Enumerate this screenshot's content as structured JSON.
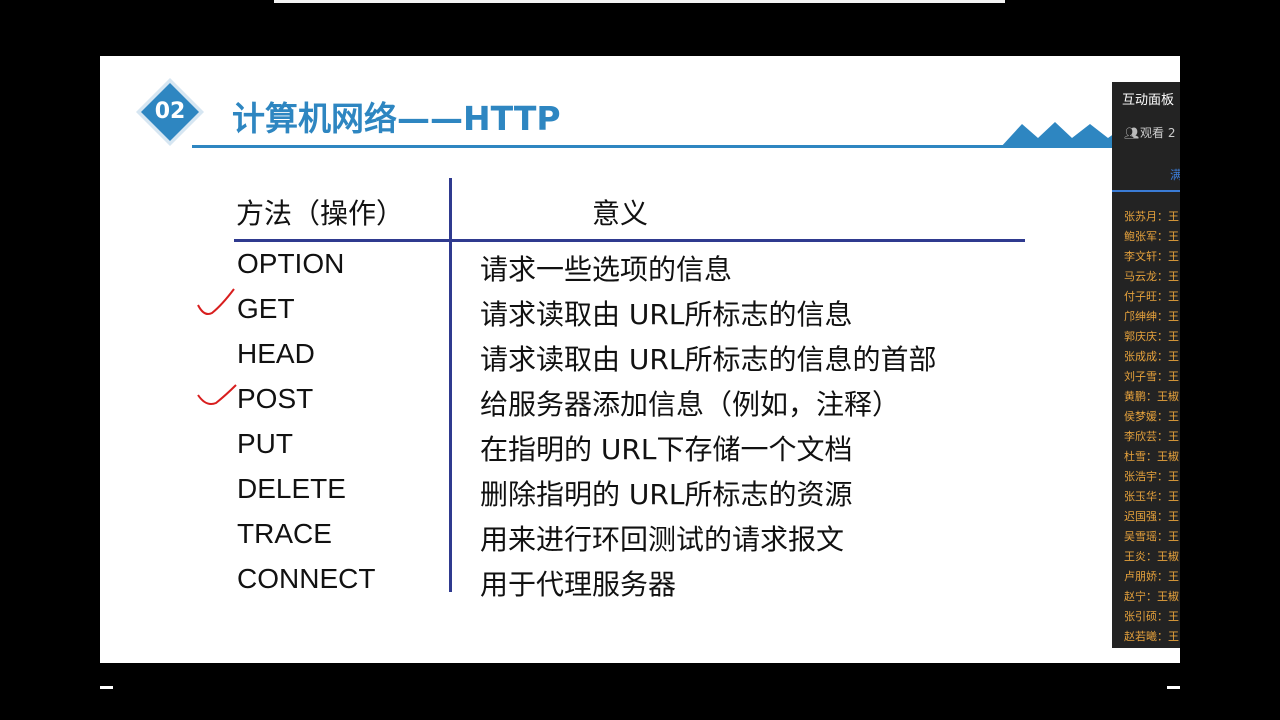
{
  "slide": {
    "badge_number": "02",
    "title": "计算机网络——HTTP",
    "table": {
      "header_method": "方法（操作）",
      "header_meaning": "意义",
      "rows": [
        {
          "method": "OPTION",
          "meaning": "请求一些选项的信息"
        },
        {
          "method": "GET",
          "meaning": "请求读取由 URL所标志的信息"
        },
        {
          "method": "HEAD",
          "meaning": "请求读取由 URL所标志的信息的首部"
        },
        {
          "method": "POST",
          "meaning": "给服务器添加信息（例如，注释）"
        },
        {
          "method": "PUT",
          "meaning": "在指明的 URL下存储一个文档"
        },
        {
          "method": "DELETE",
          "meaning": "删除指明的 URL所标志的资源"
        },
        {
          "method": "TRACE",
          "meaning": "用来进行环回测试的请求报文"
        },
        {
          "method": "CONNECT",
          "meaning": "用于代理服务器"
        }
      ]
    }
  },
  "panel": {
    "title": "互动面板",
    "watch_text": "观看 2",
    "tab_text": "满",
    "messages": [
      "张苏月：王",
      "鲍张军：王",
      "李文轩：王",
      "马云龙：王",
      "付子旺：王",
      "邝绅绅：王",
      "郭庆庆：王",
      "张成成：王",
      "刘子雪：王",
      "黄鹏：王椒",
      "侯梦媛：王",
      "李欣芸：王",
      "杜雪：王椒",
      "张浩宇：王",
      "张玉华：王",
      "迟国强：王",
      "吴雪瑶：王",
      "王炎：王椒",
      "卢朋娇：王",
      "赵宁：王椒",
      "张引硕：王",
      "赵若曦：王"
    ]
  },
  "colors": {
    "accent_blue": "#2e86c1",
    "table_rule": "#2f3a8f",
    "annotation_red": "#d81e1e",
    "panel_bg": "#232323",
    "chat_name": "#e6a23c"
  },
  "icons": {
    "badge": "diamond-badge",
    "decoration": "mountain-wave",
    "check": "checkmark-annotation",
    "viewers": "user-group-icon"
  }
}
